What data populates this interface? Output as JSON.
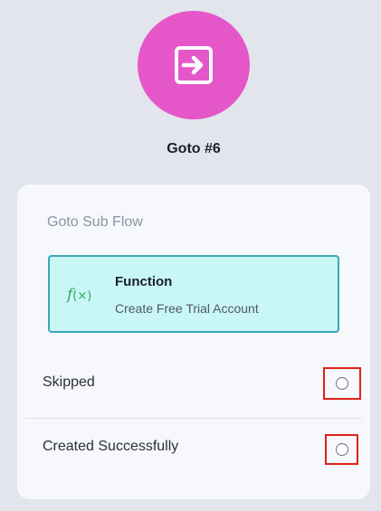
{
  "node": {
    "title": "Goto #6",
    "icon": "goto-arrow-icon",
    "color": "#e557c9"
  },
  "card": {
    "section_label": "Goto Sub Flow",
    "function": {
      "icon": "function-fx-icon",
      "icon_text": "f",
      "title": "Function",
      "subtitle": "Create Free Trial Account",
      "background": "#c8f7f6",
      "border": "#3aa8b6"
    },
    "outcomes": [
      {
        "label": "Skipped",
        "selected": false
      },
      {
        "label": "Created Successfully",
        "selected": false
      }
    ]
  }
}
